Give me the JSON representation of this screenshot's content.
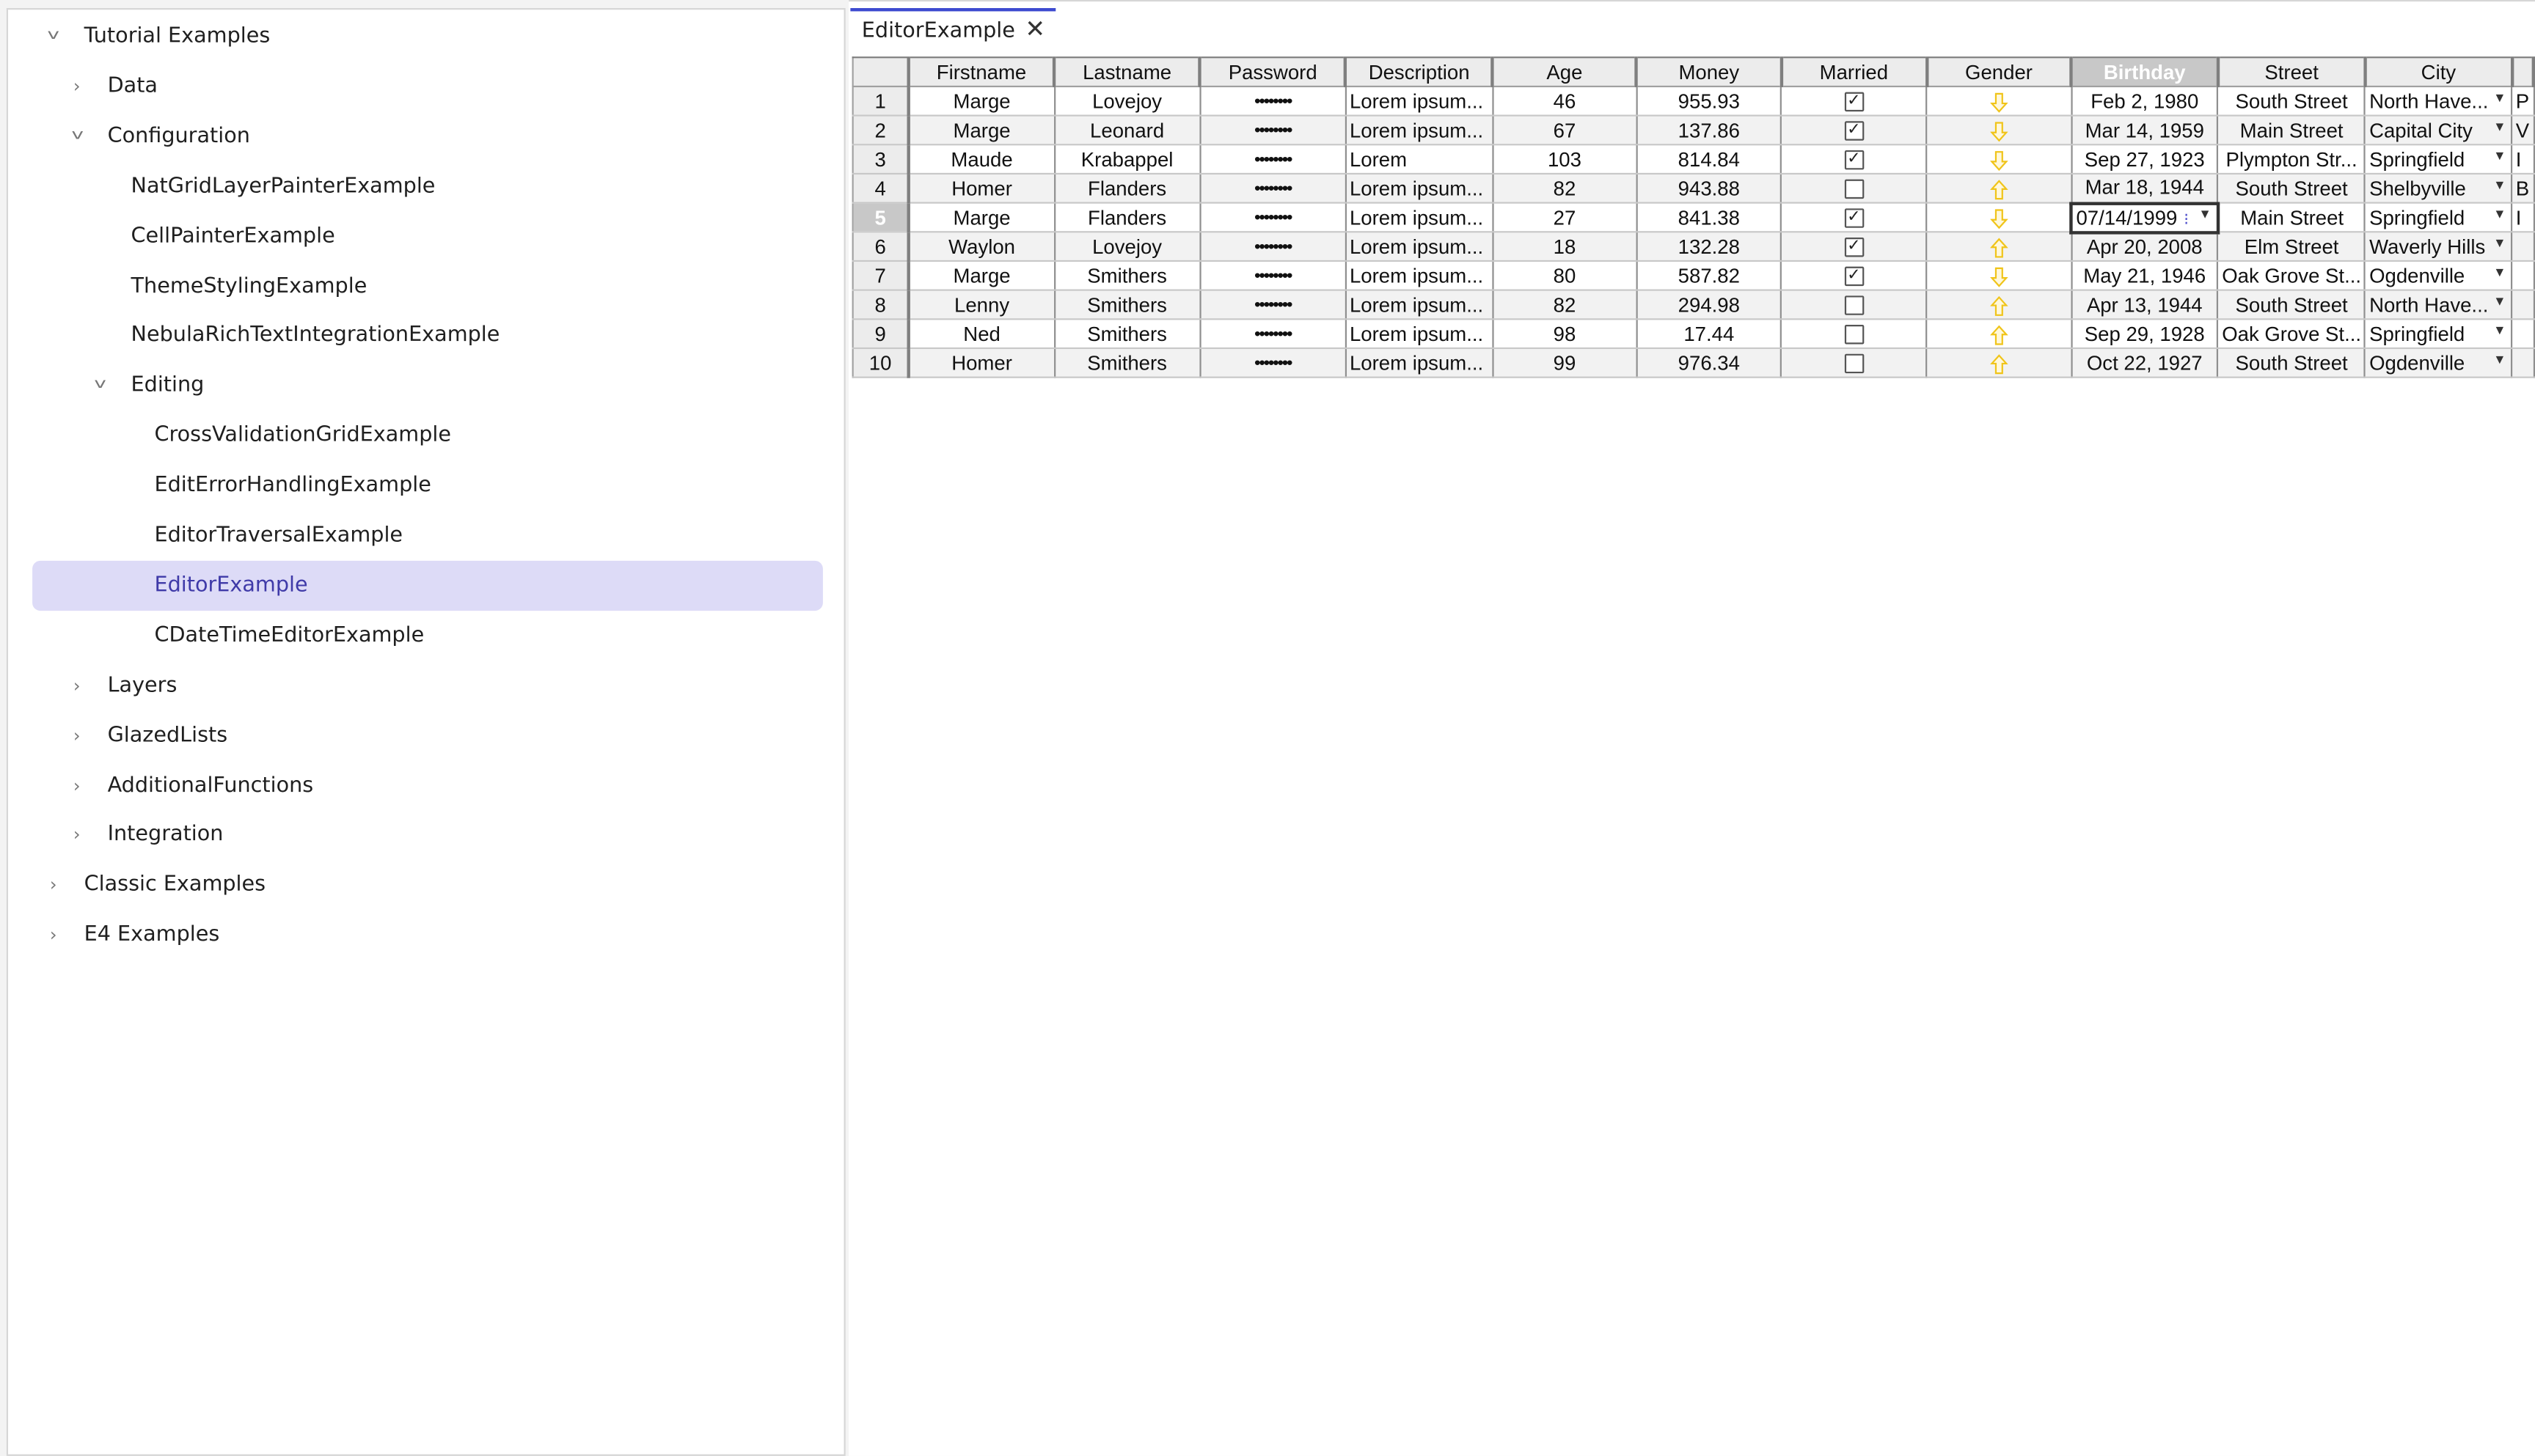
{
  "tree": {
    "items": [
      {
        "label": "Tutorial Examples",
        "expanded": true,
        "twisty": true,
        "depth": 0
      },
      {
        "label": "Data",
        "expanded": false,
        "twisty": true,
        "depth": 1
      },
      {
        "label": "Configuration",
        "expanded": true,
        "twisty": true,
        "depth": 1
      },
      {
        "label": "NatGridLayerPainterExample",
        "twisty": false,
        "depth": 2
      },
      {
        "label": "CellPainterExample",
        "twisty": false,
        "depth": 2
      },
      {
        "label": "ThemeStylingExample",
        "twisty": false,
        "depth": 2
      },
      {
        "label": "NebulaRichTextIntegrationExample",
        "twisty": false,
        "depth": 2
      },
      {
        "label": "Editing",
        "expanded": true,
        "twisty": true,
        "depth": 2
      },
      {
        "label": "CrossValidationGridExample",
        "twisty": false,
        "depth": 3
      },
      {
        "label": "EditErrorHandlingExample",
        "twisty": false,
        "depth": 3
      },
      {
        "label": "EditorTraversalExample",
        "twisty": false,
        "depth": 3
      },
      {
        "label": "EditorExample",
        "twisty": false,
        "depth": 3,
        "selected": true
      },
      {
        "label": "CDateTimeEditorExample",
        "twisty": false,
        "depth": 3
      },
      {
        "label": "Layers",
        "expanded": false,
        "twisty": true,
        "depth": 1
      },
      {
        "label": "GlazedLists",
        "expanded": false,
        "twisty": true,
        "depth": 1
      },
      {
        "label": "AdditionalFunctions",
        "expanded": false,
        "twisty": true,
        "depth": 1
      },
      {
        "label": "Integration",
        "expanded": false,
        "twisty": true,
        "depth": 1
      },
      {
        "label": "Classic Examples",
        "expanded": false,
        "twisty": true,
        "depth": 0
      },
      {
        "label": "E4 Examples",
        "expanded": false,
        "twisty": true,
        "depth": 0
      }
    ]
  },
  "editor": {
    "tab_label": "EditorExample",
    "tab_close_glyph": "✕"
  },
  "grid": {
    "columns": [
      "Firstname",
      "Lastname",
      "Password",
      "Description",
      "Age",
      "Money",
      "Married",
      "Gender",
      "Birthday",
      "Street",
      "City",
      ""
    ],
    "selected_column": "Birthday",
    "selected_row": "5",
    "editing_value": "07/14/1999",
    "rows": [
      {
        "num": "1",
        "first": "Marge",
        "last": "Lovejoy",
        "pw": "••••••••",
        "desc": "Lorem ipsum...",
        "age": "46",
        "money": "955.93",
        "married": true,
        "gender": "down",
        "birthday": "Feb 2, 1980",
        "street": "South Street",
        "city": "North Have...",
        "extra": "P"
      },
      {
        "num": "2",
        "first": "Marge",
        "last": "Leonard",
        "pw": "••••••••",
        "desc": "Lorem ipsum...",
        "age": "67",
        "money": "137.86",
        "married": true,
        "gender": "down",
        "birthday": "Mar 14, 1959",
        "street": "Main Street",
        "city": "Capital City",
        "extra": "V"
      },
      {
        "num": "3",
        "first": "Maude",
        "last": "Krabappel",
        "pw": "••••••••",
        "desc": "Lorem",
        "age": "103",
        "money": "814.84",
        "married": true,
        "gender": "down",
        "birthday": "Sep 27, 1923",
        "street": "Plympton Str...",
        "city": "Springfield",
        "extra": "I"
      },
      {
        "num": "4",
        "first": "Homer",
        "last": "Flanders",
        "pw": "••••••••",
        "desc": "Lorem ipsum...",
        "age": "82",
        "money": "943.88",
        "married": false,
        "gender": "up",
        "birthday": "Mar 18, 1944",
        "street": "South Street",
        "city": "Shelbyville",
        "extra": "B"
      },
      {
        "num": "5",
        "first": "Marge",
        "last": "Flanders",
        "pw": "••••••••",
        "desc": "Lorem ipsum...",
        "age": "27",
        "money": "841.38",
        "married": true,
        "gender": "down",
        "birthday": "07/14/1999",
        "street": "Main Street",
        "city": "Springfield",
        "extra": "I"
      },
      {
        "num": "6",
        "first": "Waylon",
        "last": "Lovejoy",
        "pw": "••••••••",
        "desc": "Lorem ipsum...",
        "age": "18",
        "money": "132.28",
        "married": true,
        "gender": "up",
        "birthday": "Apr 20, 2008",
        "street": "Elm Street",
        "city": "Waverly Hills",
        "extra": ""
      },
      {
        "num": "7",
        "first": "Marge",
        "last": "Smithers",
        "pw": "••••••••",
        "desc": "Lorem ipsum...",
        "age": "80",
        "money": "587.82",
        "married": true,
        "gender": "down",
        "birthday": "May 21, 1946",
        "street": "Oak Grove St...",
        "city": "Ogdenville",
        "extra": ""
      },
      {
        "num": "8",
        "first": "Lenny",
        "last": "Smithers",
        "pw": "••••••••",
        "desc": "Lorem ipsum...",
        "age": "82",
        "money": "294.98",
        "married": false,
        "gender": "up",
        "birthday": "Apr 13, 1944",
        "street": "South Street",
        "city": "North Have...",
        "extra": ""
      },
      {
        "num": "9",
        "first": "Ned",
        "last": "Smithers",
        "pw": "••••••••",
        "desc": "Lorem ipsum...",
        "age": "98",
        "money": "17.44",
        "married": false,
        "gender": "up",
        "birthday": "Sep 29, 1928",
        "street": "Oak Grove St...",
        "city": "Springfield",
        "extra": ""
      },
      {
        "num": "10",
        "first": "Homer",
        "last": "Smithers",
        "pw": "••••••••",
        "desc": "Lorem ipsum...",
        "age": "99",
        "money": "976.34",
        "married": false,
        "gender": "up",
        "birthday": "Oct 22, 1927",
        "street": "South Street",
        "city": "Ogdenville",
        "extra": ""
      }
    ]
  },
  "colors": {
    "selection_bg": "#dddbf7",
    "selection_text": "#3f3aa8",
    "tab_accent": "#3d4ad0",
    "gender_arrow": "#f0c419"
  }
}
